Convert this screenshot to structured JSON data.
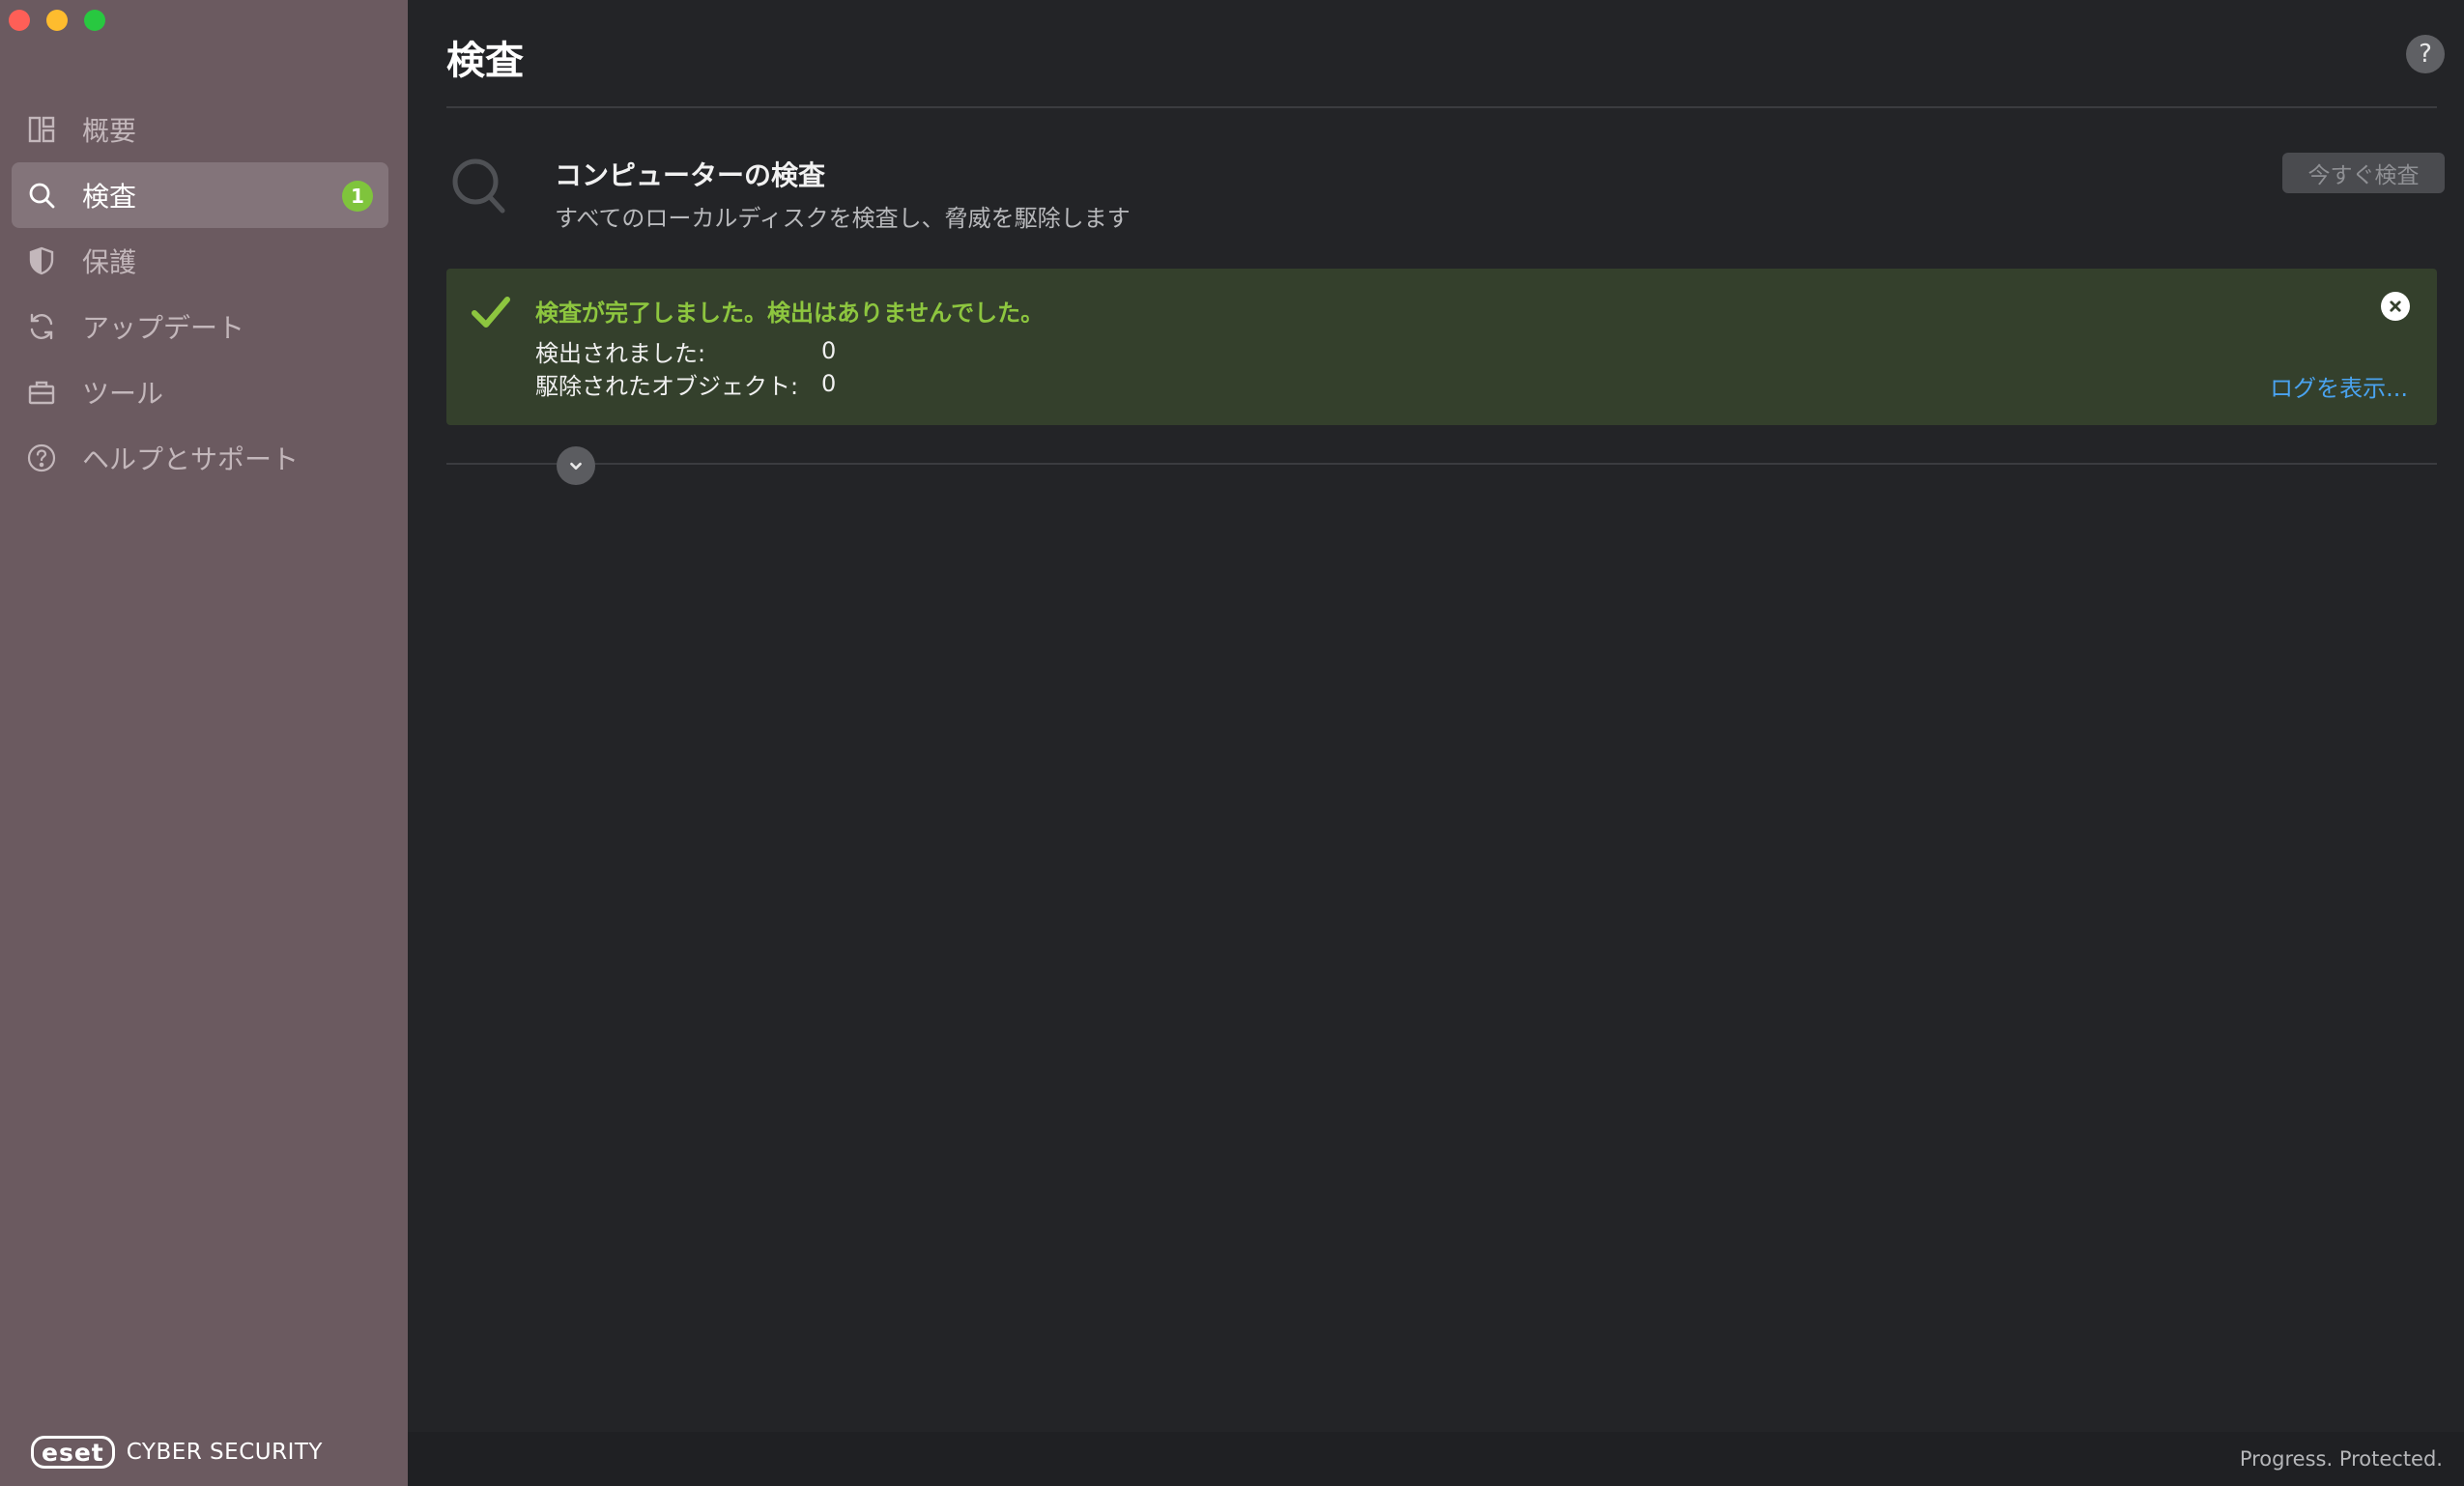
{
  "sidebar": {
    "items": [
      {
        "label": "概要",
        "icon": "dashboard-icon"
      },
      {
        "label": "検査",
        "icon": "search-icon",
        "badge": "1"
      },
      {
        "label": "保護",
        "icon": "shield-icon"
      },
      {
        "label": "アップデート",
        "icon": "refresh-icon"
      },
      {
        "label": "ツール",
        "icon": "briefcase-icon"
      },
      {
        "label": "ヘルプとサポート",
        "icon": "help-circle-icon"
      }
    ],
    "brand_logo": "eset",
    "brand_text": "CYBER SECURITY"
  },
  "header": {
    "title": "検査",
    "help_label": "?"
  },
  "scan": {
    "title": "コンピューターの検査",
    "description": "すべてのローカルディスクを検査し、脅威を駆除します",
    "button_label": "今すぐ検査"
  },
  "result": {
    "title": "検査が完了しました。検出はありませんでした。",
    "stats": [
      {
        "label": "検出されました:",
        "value": "0"
      },
      {
        "label": "駆除されたオブジェクト:",
        "value": "0"
      }
    ],
    "log_link": "ログを表示..."
  },
  "footer": {
    "tagline": "Progress. Protected."
  },
  "colors": {
    "sidebar_bg": "#6b5a60",
    "main_bg": "#232427",
    "result_bg": "#34402c",
    "success_green": "#8dc63f",
    "link_blue": "#4aa3f0",
    "badge_green": "#7fc43c"
  }
}
